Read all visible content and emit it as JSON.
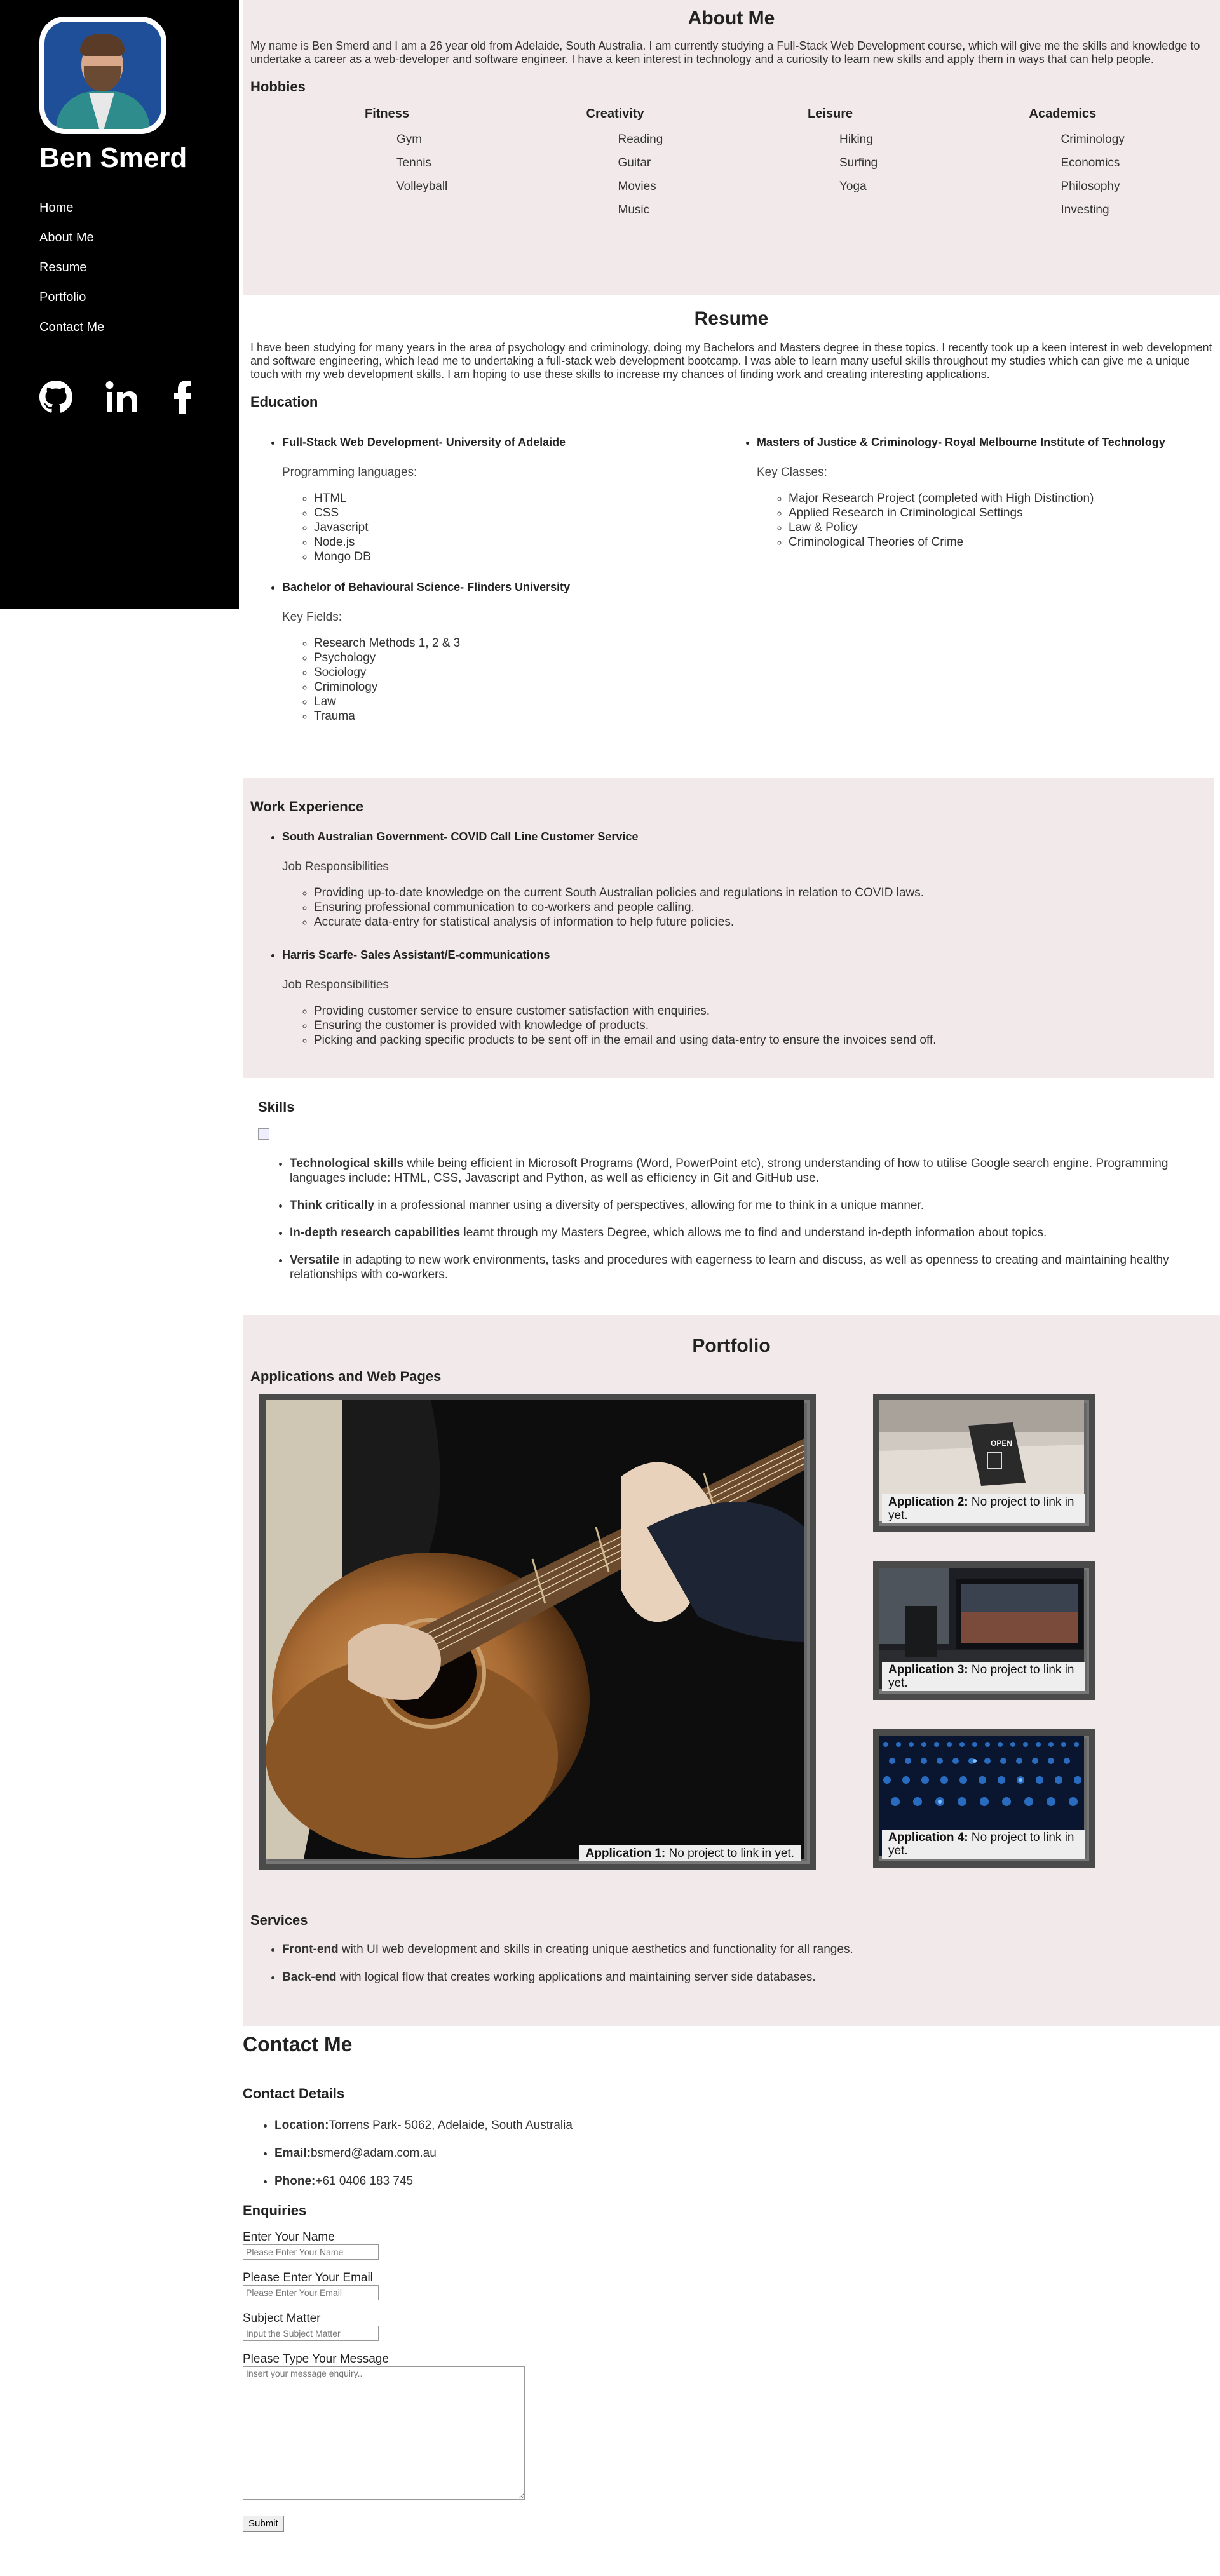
{
  "sidebar": {
    "name": "Ben Smerd",
    "nav": [
      "Home",
      "About Me",
      "Resume",
      "Portfolio",
      "Contact Me"
    ],
    "social_icons": [
      "github-icon",
      "linkedin-icon",
      "facebook-icon"
    ]
  },
  "about": {
    "title": "About Me",
    "text": "My name is Ben Smerd and I am a 26 year old from Adelaide, South Australia. I am currently studying a Full-Stack Web Development course, which will give me the skills and knowledge to undertake a career as a web-developer and software engineer. I have a keen interest in technology and a curiosity to learn new skills and apply them in ways that can help people.",
    "hobbies_title": "Hobbies",
    "hobbies": [
      {
        "heading": "Fitness",
        "items": [
          "Gym",
          "Tennis",
          "Volleyball"
        ]
      },
      {
        "heading": "Creativity",
        "items": [
          "Reading",
          "Guitar",
          "Movies",
          "Music"
        ]
      },
      {
        "heading": "Leisure",
        "items": [
          "Hiking",
          "Surfing",
          "Yoga"
        ]
      },
      {
        "heading": "Academics",
        "items": [
          "Criminology",
          "Economics",
          "Philosophy",
          "Investing"
        ]
      }
    ]
  },
  "resume": {
    "title": "Resume",
    "text": "I have been studying for many years in the area of psychology and criminology, doing my Bachelors and Masters degree in these topics. I recently took up a keen interest in web development and software engineering, which lead me to undertaking a full-stack web development bootcamp. I was able to learn many useful skills throughout my studies which can give me a unique touch with my web development skills. I am hoping to use these skills to increase my chances of finding work and creating interesting applications.",
    "education_title": "Education",
    "education_left": [
      {
        "degree": "Full-Stack Web Development- University of Adelaide",
        "kind": "Programming languages:",
        "items": [
          "HTML",
          "CSS",
          "Javascript",
          "Node.js",
          "Mongo DB"
        ]
      },
      {
        "degree": "Bachelor of Behavioural Science- Flinders University",
        "kind": "Key Fields:",
        "items": [
          "Research Methods 1, 2 & 3",
          "Psychology",
          "Sociology",
          "Criminology",
          "Law",
          "Trauma"
        ]
      }
    ],
    "education_right": [
      {
        "degree": "Masters of Justice & Criminology- Royal Melbourne Institute of Technology",
        "kind": "Key Classes:",
        "items": [
          "Major Research Project (completed with High Distinction)",
          "Applied Research in Criminological Settings",
          "Law & Policy",
          "Criminological Theories of Crime"
        ]
      }
    ]
  },
  "work": {
    "title": "Work Experience",
    "jobs": [
      {
        "title": "South Australian Government- COVID Call Line Customer Service",
        "kind": "Job Responsibilities",
        "items": [
          "Providing up-to-date knowledge on the current South Australian policies and regulations in relation to COVID laws.",
          "Ensuring professional communication to co-workers and people calling.",
          "Accurate data-entry for statistical analysis of information to help future policies."
        ]
      },
      {
        "title": "Harris Scarfe- Sales Assistant/E-communications",
        "kind": "Job Responsibilities",
        "items": [
          "Providing customer service to ensure customer satisfaction with enquiries.",
          "Ensuring the customer is provided with knowledge of products.",
          "Picking and packing specific products to be sent off in the email and using data-entry to ensure the invoices send off."
        ]
      }
    ]
  },
  "skills": {
    "title": "Skills",
    "items": [
      {
        "bold": "Technological skills",
        "text": " while being efficient in Microsoft Programs (Word, PowerPoint etc), strong understanding of how to utilise Google search engine. Programming languages include: HTML, CSS, Javascript and Python, as well as efficiency in Git and GitHub use."
      },
      {
        "bold": "Think critically",
        "text": " in a professional manner using a diversity of perspectives, allowing for me to think in a unique manner."
      },
      {
        "bold": "In-depth research capabilities",
        "text": " learnt through my Masters Degree, which allows me to find and understand in-depth information about topics."
      },
      {
        "bold": "Versatile",
        "text": " in adapting to new work environments, tasks and procedures with eagerness to learn and discuss, as well as openness to creating and maintaining healthy relationships with co-workers."
      }
    ]
  },
  "portfolio": {
    "title": "Portfolio",
    "subtitle": "Applications and Web Pages",
    "apps": [
      {
        "label": "Application 1:",
        "text": " No project to link in yet."
      },
      {
        "label": "Application 2:",
        "text": " No project to link in yet."
      },
      {
        "label": "Application 3:",
        "text": " No project to link in yet."
      },
      {
        "label": "Application 4:",
        "text": " No project to link in yet."
      }
    ],
    "app2_sign": "OPEN",
    "services_title": "Services",
    "services": [
      {
        "bold": "Front-end",
        "text": " with UI web development and skills in creating unique aesthetics and functionality for all ranges."
      },
      {
        "bold": "Back-end",
        "text": " with logical flow that creates working applications and maintaining server side databases."
      }
    ]
  },
  "contact": {
    "title": "Contact Me",
    "details_title": "Contact Details",
    "details": [
      {
        "label": "Location:",
        "value": "Torrens Park- 5062, Adelaide, South Australia"
      },
      {
        "label": "Email:",
        "value": "bsmerd@adam.com.au"
      },
      {
        "label": "Phone:",
        "value": "+61 0406 183 745"
      }
    ],
    "enquiries_title": "Enquiries",
    "fields": {
      "name_label": "Enter Your Name",
      "name_placeholder": "Please Enter Your Name",
      "email_label": "Please Enter Your Email",
      "email_placeholder": "Please Enter Your Email",
      "subject_label": "Subject Matter",
      "subject_placeholder": "Input the Subject Matter",
      "message_label": "Please Type Your Message",
      "message_placeholder": "Insert your message enquiry..",
      "submit_label": "Submit"
    }
  }
}
